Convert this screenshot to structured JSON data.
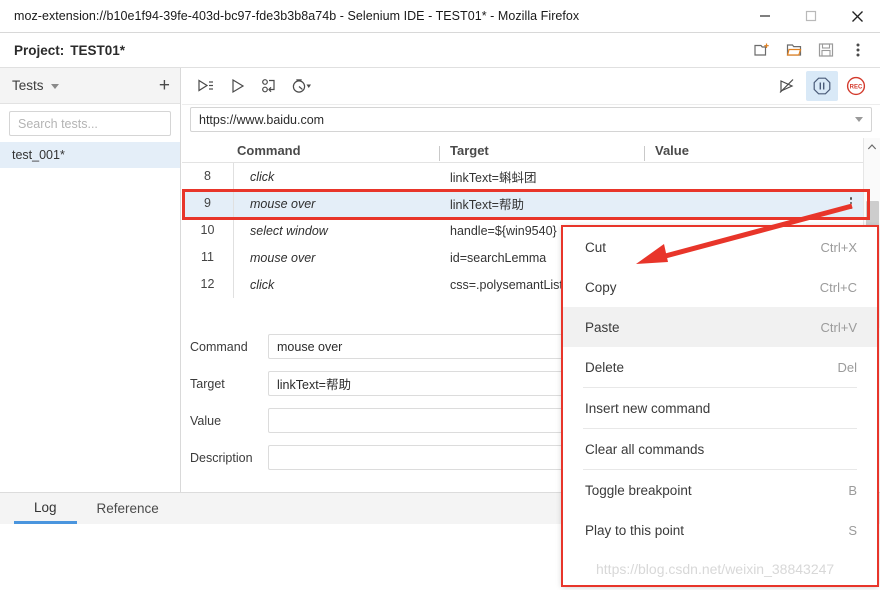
{
  "window": {
    "title": "moz-extension://b10e1f94-39fe-403d-bc97-fde3b3b8a74b - Selenium IDE - TEST01* - Mozilla Firefox",
    "minimize": "minimize-icon",
    "maximize": "maximize-icon",
    "close": "close-icon"
  },
  "project": {
    "label": "Project:",
    "name": "TEST01*",
    "icons": [
      "new-project-icon",
      "open-project-icon",
      "save-project-icon",
      "more-options-icon"
    ]
  },
  "sidebar": {
    "heading": "Tests",
    "add_label": "+",
    "search_placeholder": "Search tests...",
    "search_value": "",
    "items": [
      {
        "label": "test_001*",
        "selected": true
      }
    ]
  },
  "toolbar": {
    "left_icons": [
      "run-all-tests-icon",
      "run-current-test-icon",
      "step-over-icon",
      "speed-control-icon"
    ],
    "right_icons": [
      "disable-breakpoints-icon",
      "pause-icon",
      "record-icon"
    ]
  },
  "url_bar": {
    "value": "https://www.baidu.com",
    "dropdown": "chevron-down-icon"
  },
  "table": {
    "headers": [
      "",
      "Command",
      "Target",
      "Value"
    ],
    "rows": [
      {
        "index": "8",
        "command": "click",
        "target": "linkText=蝌蚪团",
        "value": "",
        "selected": false
      },
      {
        "index": "9",
        "command": "mouse over",
        "target": "linkText=帮助",
        "value": "",
        "selected": true
      },
      {
        "index": "10",
        "command": "select window",
        "target": "handle=${win9540}",
        "value": "",
        "selected": false
      },
      {
        "index": "11",
        "command": "mouse over",
        "target": "id=searchLemma",
        "value": "",
        "selected": false
      },
      {
        "index": "12",
        "command": "click",
        "target": "css=.polysemantList-",
        "value": "",
        "selected": false
      }
    ],
    "scroll_up": "chevron-up-icon",
    "scroll_down": "chevron-down-icon"
  },
  "form": {
    "fields": [
      {
        "label": "Command",
        "value": "mouse over"
      },
      {
        "label": "Target",
        "value": "linkText=帮助"
      },
      {
        "label": "Value",
        "value": ""
      },
      {
        "label": "Description",
        "value": ""
      }
    ]
  },
  "context_menu": {
    "items": [
      {
        "label": "Cut",
        "shortcut": "Ctrl+X",
        "hover": false
      },
      {
        "label": "Copy",
        "shortcut": "Ctrl+C",
        "hover": false
      },
      {
        "label": "Paste",
        "shortcut": "Ctrl+V",
        "hover": true
      },
      {
        "label": "Delete",
        "shortcut": "Del",
        "hover": false
      },
      {
        "label": "Insert new command",
        "shortcut": "",
        "hover": false
      },
      {
        "label": "Clear all commands",
        "shortcut": "",
        "hover": false
      },
      {
        "label": "Toggle breakpoint",
        "shortcut": "B",
        "hover": false
      },
      {
        "label": "Play to this point",
        "shortcut": "S",
        "hover": false
      }
    ]
  },
  "tabs": [
    {
      "label": "Log",
      "active": true
    },
    {
      "label": "Reference",
      "active": false
    }
  ],
  "watermark": "https://blog.csdn.net/weixin_38843247",
  "colors": {
    "accent": "#4a95de",
    "selection": "#e4eef8",
    "annotation": "#e8352a",
    "record": "#d33a2c"
  }
}
